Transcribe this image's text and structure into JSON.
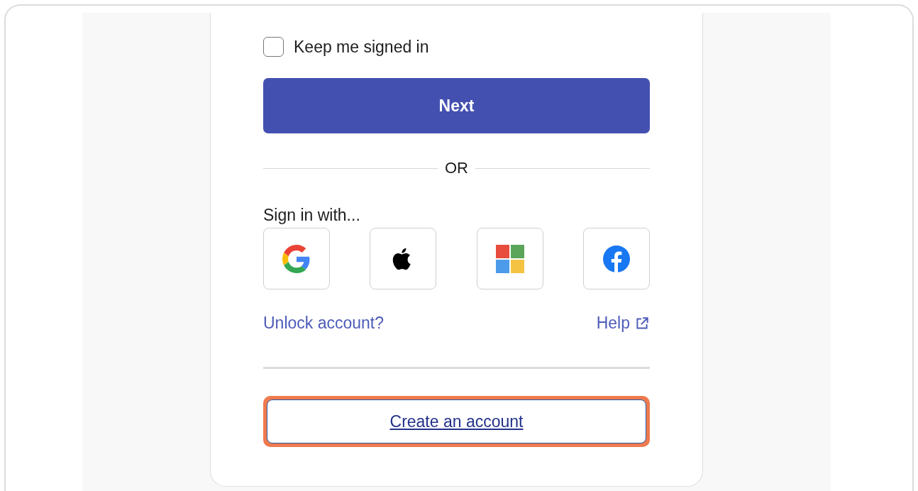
{
  "keep_signed_in": {
    "label": "Keep me signed in",
    "checked": false
  },
  "next_button": "Next",
  "divider_text": "OR",
  "sign_in_with": {
    "label": "Sign in with...",
    "providers": [
      {
        "kind": "google"
      },
      {
        "kind": "apple"
      },
      {
        "kind": "microsoft"
      },
      {
        "kind": "facebook"
      }
    ]
  },
  "links": {
    "unlock": "Unlock account?",
    "help": "Help"
  },
  "create_account": {
    "label": "Create an account",
    "highlighted": true
  }
}
